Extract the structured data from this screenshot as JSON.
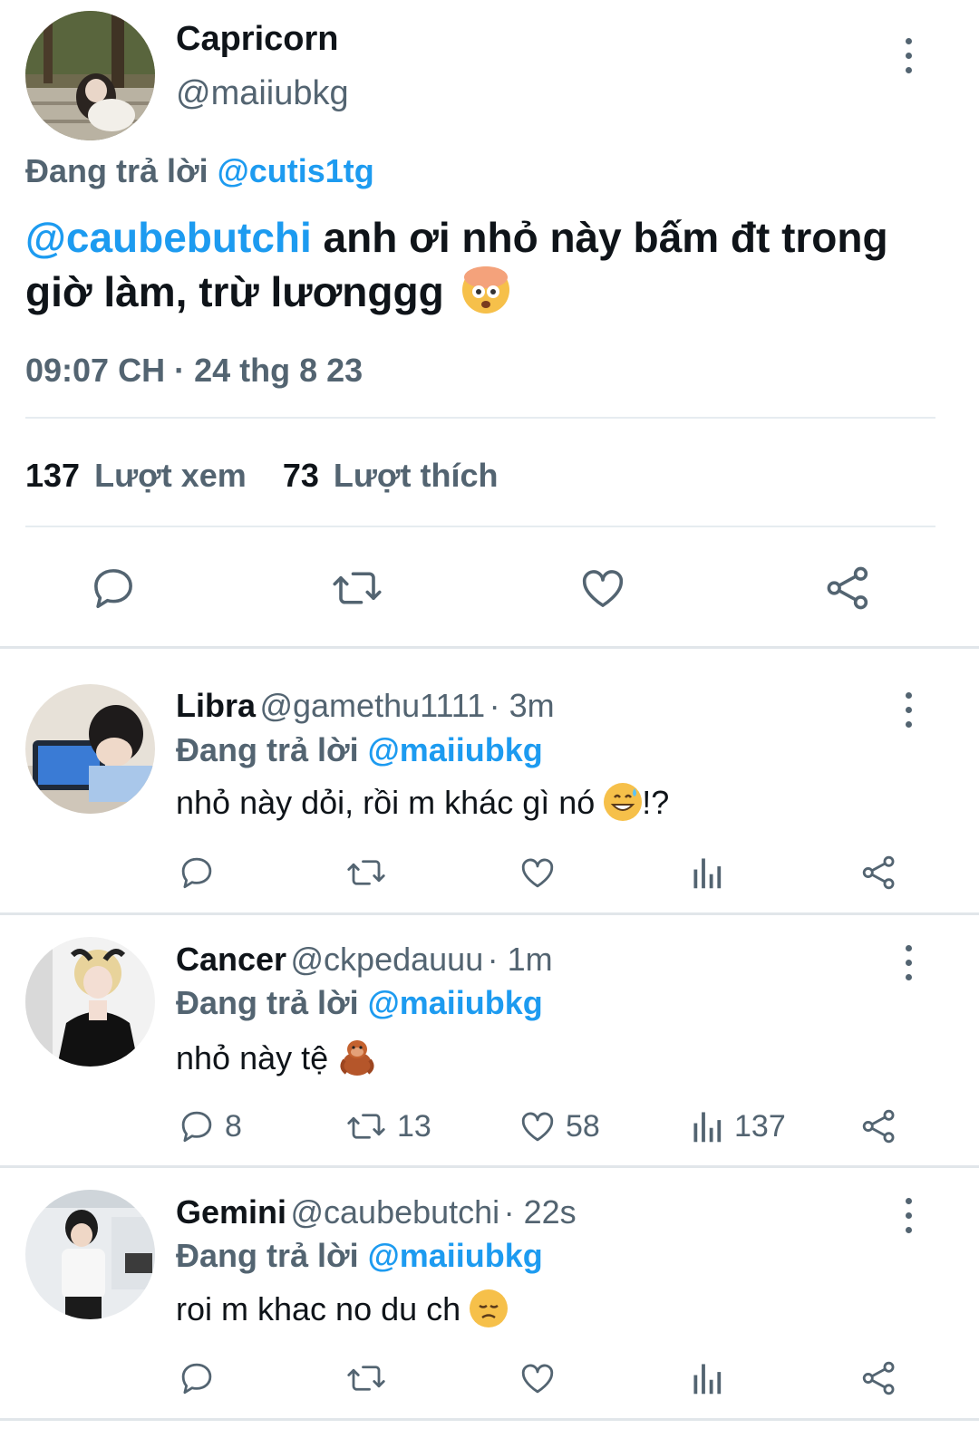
{
  "main_tweet": {
    "name": "Capricorn",
    "handle": "@maiiubkg",
    "replying_prefix": "Đang trả lời",
    "replying_to": "@cutis1tg",
    "mention": "@caubebutchi",
    "text": " anh ơi nhỏ này bấm đt trong giờ làm, trừ lươnggg",
    "timestamp": "09:07 CH · 24 thg 8 23",
    "views_count": "137",
    "views_label": "Lượt xem",
    "likes_count": "73",
    "likes_label": "Lượt thích"
  },
  "replies": [
    {
      "name": "Libra",
      "handle": "@gamethu1111",
      "time": "· 3m",
      "replying_prefix": "Đang trả lời",
      "replying_to": "@maiiubkg",
      "text_before": "nhỏ này dỏi, rồi m khác gì nó ",
      "text_after": "!?",
      "counts": {
        "reply": "",
        "retweet": "",
        "like": "",
        "views": ""
      }
    },
    {
      "name": "Cancer",
      "handle": "@ckpedauuu",
      "time": "· 1m",
      "replying_prefix": "Đang trả lời",
      "replying_to": "@maiiubkg",
      "text_before": "nhỏ này tệ ",
      "text_after": "",
      "counts": {
        "reply": "8",
        "retweet": "13",
        "like": "58",
        "views": "137"
      }
    },
    {
      "name": "Gemini",
      "handle": "@caubebutchi",
      "time": "· 22s",
      "replying_prefix": "Đang trả lời",
      "replying_to": "@maiiubkg",
      "text_before": "roi m khac no du ch ",
      "text_after": "",
      "counts": {
        "reply": "",
        "retweet": "",
        "like": "",
        "views": ""
      }
    }
  ],
  "icons": {
    "reply": "speech-bubble-icon",
    "retweet": "retweet-icon",
    "like": "heart-icon",
    "views": "bar-chart-icon",
    "share": "share-icon",
    "more": "kebab-menu-icon"
  },
  "colors": {
    "link": "#1d9bf0",
    "muted": "#536471",
    "text": "#0f1419"
  }
}
